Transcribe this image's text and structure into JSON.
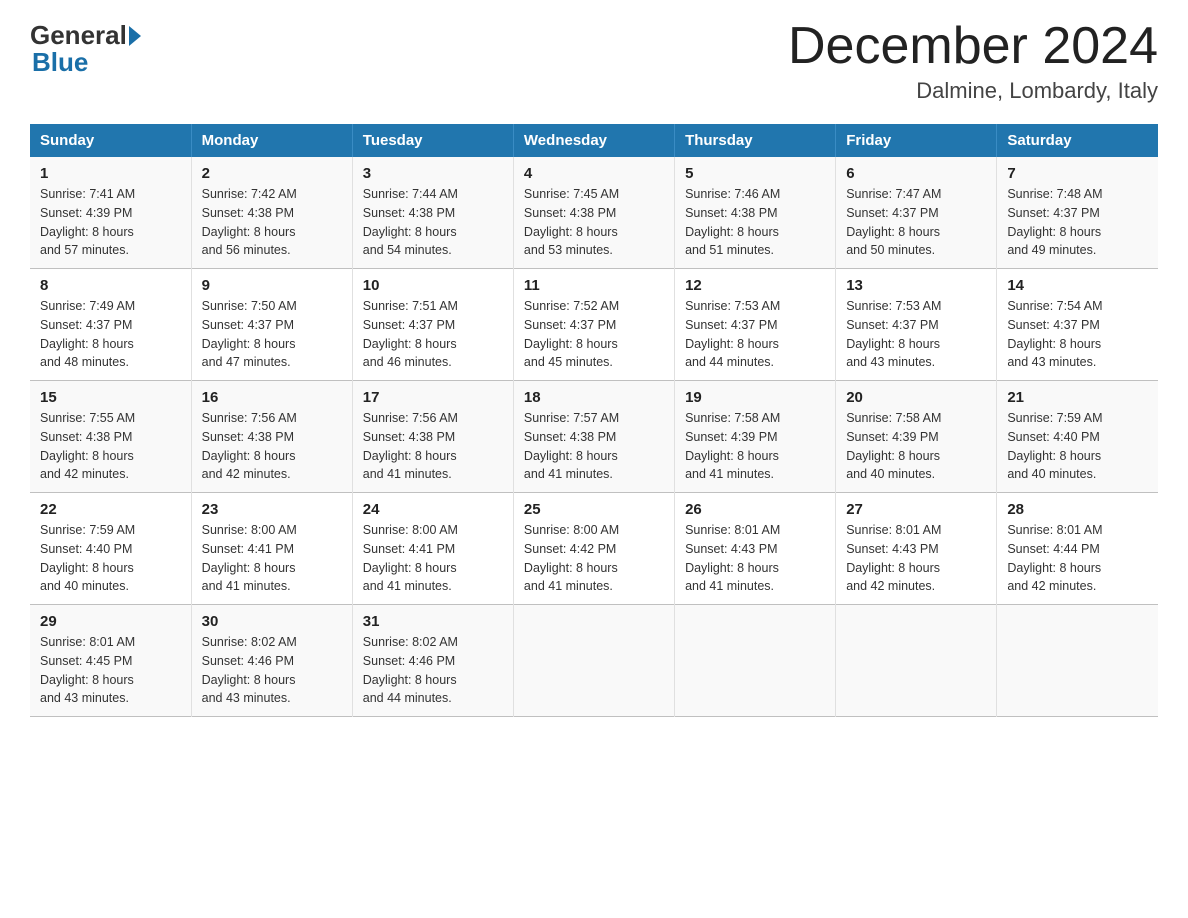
{
  "header": {
    "logo_general": "General",
    "logo_blue": "Blue",
    "month_title": "December 2024",
    "subtitle": "Dalmine, Lombardy, Italy"
  },
  "days_of_week": [
    "Sunday",
    "Monday",
    "Tuesday",
    "Wednesday",
    "Thursday",
    "Friday",
    "Saturday"
  ],
  "weeks": [
    [
      {
        "day": "1",
        "sunrise": "7:41 AM",
        "sunset": "4:39 PM",
        "daylight": "8 hours and 57 minutes."
      },
      {
        "day": "2",
        "sunrise": "7:42 AM",
        "sunset": "4:38 PM",
        "daylight": "8 hours and 56 minutes."
      },
      {
        "day": "3",
        "sunrise": "7:44 AM",
        "sunset": "4:38 PM",
        "daylight": "8 hours and 54 minutes."
      },
      {
        "day": "4",
        "sunrise": "7:45 AM",
        "sunset": "4:38 PM",
        "daylight": "8 hours and 53 minutes."
      },
      {
        "day": "5",
        "sunrise": "7:46 AM",
        "sunset": "4:38 PM",
        "daylight": "8 hours and 51 minutes."
      },
      {
        "day": "6",
        "sunrise": "7:47 AM",
        "sunset": "4:37 PM",
        "daylight": "8 hours and 50 minutes."
      },
      {
        "day": "7",
        "sunrise": "7:48 AM",
        "sunset": "4:37 PM",
        "daylight": "8 hours and 49 minutes."
      }
    ],
    [
      {
        "day": "8",
        "sunrise": "7:49 AM",
        "sunset": "4:37 PM",
        "daylight": "8 hours and 48 minutes."
      },
      {
        "day": "9",
        "sunrise": "7:50 AM",
        "sunset": "4:37 PM",
        "daylight": "8 hours and 47 minutes."
      },
      {
        "day": "10",
        "sunrise": "7:51 AM",
        "sunset": "4:37 PM",
        "daylight": "8 hours and 46 minutes."
      },
      {
        "day": "11",
        "sunrise": "7:52 AM",
        "sunset": "4:37 PM",
        "daylight": "8 hours and 45 minutes."
      },
      {
        "day": "12",
        "sunrise": "7:53 AM",
        "sunset": "4:37 PM",
        "daylight": "8 hours and 44 minutes."
      },
      {
        "day": "13",
        "sunrise": "7:53 AM",
        "sunset": "4:37 PM",
        "daylight": "8 hours and 43 minutes."
      },
      {
        "day": "14",
        "sunrise": "7:54 AM",
        "sunset": "4:37 PM",
        "daylight": "8 hours and 43 minutes."
      }
    ],
    [
      {
        "day": "15",
        "sunrise": "7:55 AM",
        "sunset": "4:38 PM",
        "daylight": "8 hours and 42 minutes."
      },
      {
        "day": "16",
        "sunrise": "7:56 AM",
        "sunset": "4:38 PM",
        "daylight": "8 hours and 42 minutes."
      },
      {
        "day": "17",
        "sunrise": "7:56 AM",
        "sunset": "4:38 PM",
        "daylight": "8 hours and 41 minutes."
      },
      {
        "day": "18",
        "sunrise": "7:57 AM",
        "sunset": "4:38 PM",
        "daylight": "8 hours and 41 minutes."
      },
      {
        "day": "19",
        "sunrise": "7:58 AM",
        "sunset": "4:39 PM",
        "daylight": "8 hours and 41 minutes."
      },
      {
        "day": "20",
        "sunrise": "7:58 AM",
        "sunset": "4:39 PM",
        "daylight": "8 hours and 40 minutes."
      },
      {
        "day": "21",
        "sunrise": "7:59 AM",
        "sunset": "4:40 PM",
        "daylight": "8 hours and 40 minutes."
      }
    ],
    [
      {
        "day": "22",
        "sunrise": "7:59 AM",
        "sunset": "4:40 PM",
        "daylight": "8 hours and 40 minutes."
      },
      {
        "day": "23",
        "sunrise": "8:00 AM",
        "sunset": "4:41 PM",
        "daylight": "8 hours and 41 minutes."
      },
      {
        "day": "24",
        "sunrise": "8:00 AM",
        "sunset": "4:41 PM",
        "daylight": "8 hours and 41 minutes."
      },
      {
        "day": "25",
        "sunrise": "8:00 AM",
        "sunset": "4:42 PM",
        "daylight": "8 hours and 41 minutes."
      },
      {
        "day": "26",
        "sunrise": "8:01 AM",
        "sunset": "4:43 PM",
        "daylight": "8 hours and 41 minutes."
      },
      {
        "day": "27",
        "sunrise": "8:01 AM",
        "sunset": "4:43 PM",
        "daylight": "8 hours and 42 minutes."
      },
      {
        "day": "28",
        "sunrise": "8:01 AM",
        "sunset": "4:44 PM",
        "daylight": "8 hours and 42 minutes."
      }
    ],
    [
      {
        "day": "29",
        "sunrise": "8:01 AM",
        "sunset": "4:45 PM",
        "daylight": "8 hours and 43 minutes."
      },
      {
        "day": "30",
        "sunrise": "8:02 AM",
        "sunset": "4:46 PM",
        "daylight": "8 hours and 43 minutes."
      },
      {
        "day": "31",
        "sunrise": "8:02 AM",
        "sunset": "4:46 PM",
        "daylight": "8 hours and 44 minutes."
      },
      null,
      null,
      null,
      null
    ]
  ],
  "labels": {
    "sunrise": "Sunrise:",
    "sunset": "Sunset:",
    "daylight": "Daylight:"
  }
}
